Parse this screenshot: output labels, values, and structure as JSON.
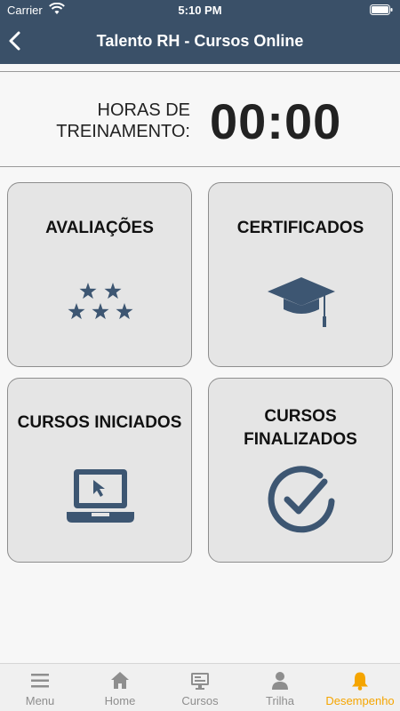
{
  "status": {
    "carrier": "Carrier",
    "time": "5:10 PM"
  },
  "header": {
    "title": "Talento RH - Cursos Online"
  },
  "training": {
    "label": "HORAS DE TREINAMENTO:",
    "value": "00:00"
  },
  "cards": [
    {
      "title": "AVALIAÇÕES",
      "icon": "stars-icon"
    },
    {
      "title": "CERTIFICADOS",
      "icon": "graduation-cap-icon"
    },
    {
      "title": "CURSOS INICIADOS",
      "icon": "laptop-icon"
    },
    {
      "title": "CURSOS FINALIZADOS",
      "icon": "check-circle-icon"
    }
  ],
  "tabs": [
    {
      "label": "Menu",
      "icon": "menu-icon"
    },
    {
      "label": "Home",
      "icon": "home-icon"
    },
    {
      "label": "Cursos",
      "icon": "monitor-icon"
    },
    {
      "label": "Trilha",
      "icon": "person-icon"
    },
    {
      "label": "Desempenho",
      "icon": "bell-icon",
      "active": true
    }
  ],
  "colors": {
    "header": "#3a5068",
    "icon": "#3d5672",
    "active_tab": "#f5a500",
    "inactive_tab": "#8e8e8e"
  }
}
